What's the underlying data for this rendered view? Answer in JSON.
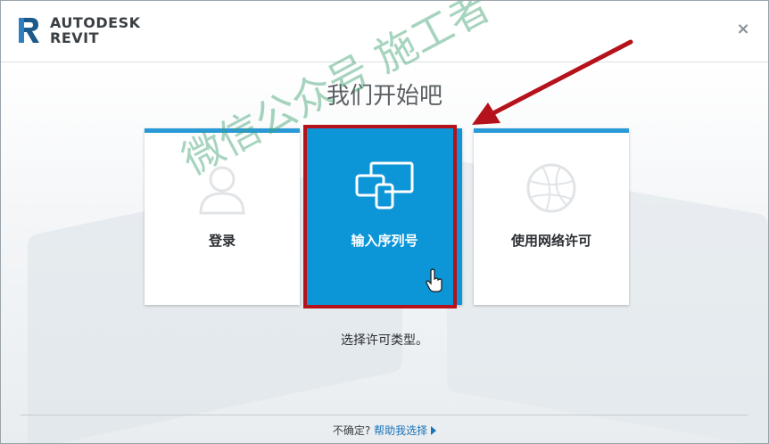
{
  "window": {
    "brand_line1": "AUTODESK",
    "brand_line2": "REVIT",
    "close_label": "×"
  },
  "main": {
    "heading": "我们开始吧",
    "subtext": "选择许可类型。",
    "cards": [
      {
        "label": "登录",
        "icon": "user-silhouette-icon"
      },
      {
        "label": "输入序列号",
        "icon": "devices-icon",
        "selected": true
      },
      {
        "label": "使用网络许可",
        "icon": "network-globe-icon"
      }
    ]
  },
  "footer": {
    "question": "不确定?",
    "link": "帮助我选择"
  },
  "watermark": "微信公众号 施工者",
  "colors": {
    "accent": "#0c96d8",
    "card_top": "#2a9ad6",
    "highlight": "#b5121b",
    "link": "#1a73b8"
  }
}
